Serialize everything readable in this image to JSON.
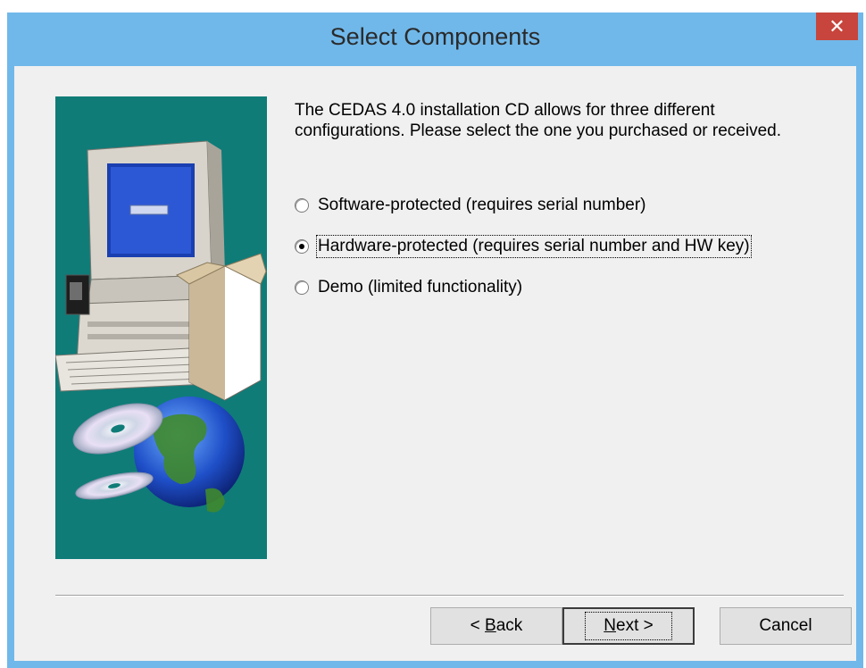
{
  "window": {
    "title": "Select Components",
    "close_glyph": "✕"
  },
  "intro_text": "The CEDAS 4.0 installation CD allows for three different configurations.  Please select the one you purchased or received.",
  "options": [
    {
      "label": "Software-protected (requires serial number)",
      "selected": false
    },
    {
      "label": "Hardware-protected (requires serial number and HW key)",
      "selected": true
    },
    {
      "label": "Demo (limited functionality)",
      "selected": false
    }
  ],
  "buttons": {
    "back_prefix": "< ",
    "back_mnemonic": "B",
    "back_rest": "ack",
    "next_mnemonic": "N",
    "next_rest": "ext >",
    "cancel": "Cancel"
  },
  "colors": {
    "title_bar": "#70b8ea",
    "close": "#c7453c",
    "art_bg": "#0f7c78"
  },
  "icons": [
    "computer-illustration",
    "cd-disc-icon",
    "globe-icon",
    "close-icon"
  ]
}
